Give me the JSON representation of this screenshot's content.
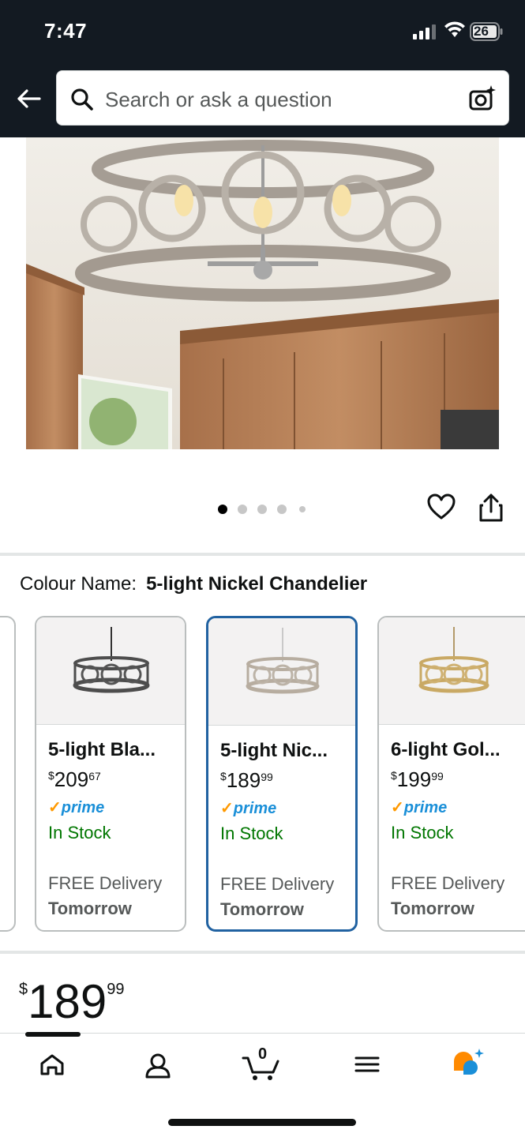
{
  "status_bar": {
    "time": "7:47",
    "battery": "26"
  },
  "search": {
    "placeholder": "Search or ask a question"
  },
  "gallery": {
    "image_count": 5,
    "active_index": 0
  },
  "colour": {
    "label": "Colour Name:",
    "value": "5-light Nickel Chandelier"
  },
  "variants": [
    {
      "title": "5-light Bla...",
      "price_symbol": "$",
      "price_whole": "209",
      "price_fraction": "67",
      "prime": "prime",
      "stock": "In Stock",
      "delivery": "FREE Delivery",
      "delivery_day": "Tomorrow",
      "selected": false
    },
    {
      "title": "5-light Nic...",
      "price_symbol": "$",
      "price_whole": "189",
      "price_fraction": "99",
      "prime": "prime",
      "stock": "In Stock",
      "delivery": "FREE Delivery",
      "delivery_day": "Tomorrow",
      "selected": true
    },
    {
      "title": "6-light Gol...",
      "price_symbol": "$",
      "price_whole": "199",
      "price_fraction": "99",
      "prime": "prime",
      "stock": "In Stock",
      "delivery": "FREE Delivery",
      "delivery_day": "Tomorrow",
      "selected": false
    }
  ],
  "price": {
    "symbol": "$",
    "whole": "189",
    "fraction": "99"
  },
  "cart": {
    "count": "0"
  },
  "tabs": [
    "home-icon",
    "account-icon",
    "cart-icon",
    "menu-icon",
    "rufus-ai-icon"
  ],
  "colors": {
    "header": "#131a22",
    "selected_border": "#2162a1",
    "in_stock": "#007600",
    "prime_blue": "#1a8fd8",
    "prime_check": "#ff9900"
  }
}
